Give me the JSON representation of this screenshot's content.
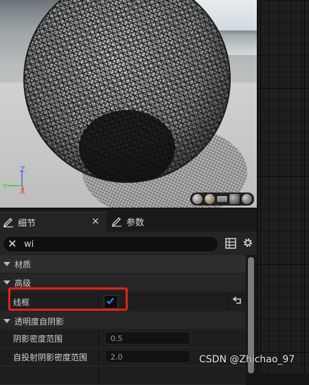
{
  "viewport": {
    "axis": {
      "z": "Z",
      "x": "X",
      "y": "Y"
    },
    "view_modes": [
      "wire-sphere",
      "lit-sphere",
      "flat-plane",
      "cube",
      "gear"
    ]
  },
  "tabs": [
    {
      "label": "细节",
      "icon": "pencil-icon",
      "active": true,
      "close": "×"
    },
    {
      "label": "参数",
      "icon": "pencil-icon",
      "active": false
    }
  ],
  "search": {
    "value": "wi",
    "clear": "✕"
  },
  "categories": {
    "material": "材质",
    "advanced": "高级",
    "translucency": "透明度自阴影"
  },
  "properties": {
    "wireframe": {
      "label": "线框",
      "checked": true
    },
    "shadow_density": {
      "label": "阴影密度范围",
      "value": "0.5"
    },
    "self_shadow_density": {
      "label": "自投射阴影密度范围",
      "value": "2.0"
    }
  },
  "watermark": "CSDN @Zhichao_97",
  "colors": {
    "highlight": "#e8201b",
    "check": "#2f86e8",
    "panel": "#242424"
  }
}
